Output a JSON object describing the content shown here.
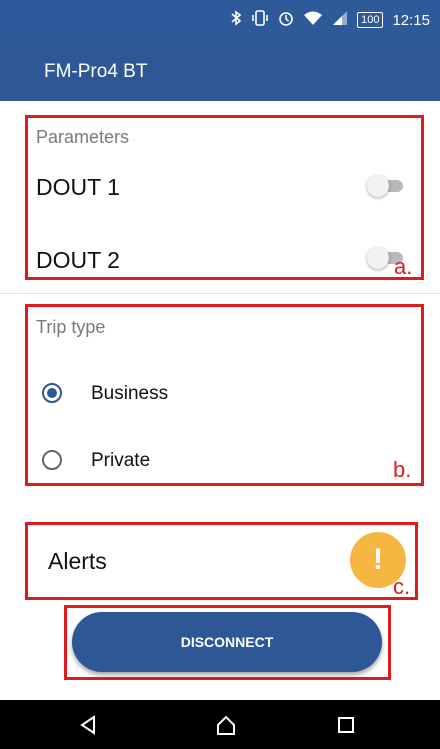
{
  "status_bar": {
    "battery": "100",
    "time": "12:15",
    "icons": [
      "bluetooth-icon",
      "vibrate-icon",
      "alarm-icon",
      "wifi-icon",
      "signal-icon"
    ]
  },
  "app_bar": {
    "title": "FM-Pro4 BT"
  },
  "parameters": {
    "heading": "Parameters",
    "items": [
      {
        "label": "DOUT 1",
        "enabled": false
      },
      {
        "label": "DOUT 2",
        "enabled": false
      }
    ],
    "annotation": "a."
  },
  "trip_type": {
    "heading": "Trip type",
    "options": [
      {
        "label": "Business",
        "selected": true
      },
      {
        "label": "Private",
        "selected": false
      }
    ],
    "annotation": "b."
  },
  "alerts": {
    "label": "Alerts",
    "icon_symbol": "!",
    "icon_color": "#f5b642",
    "annotation": "c."
  },
  "disconnect_label": "DISCONNECT",
  "colors": {
    "primary": "#2e5795",
    "highlight": "#e01b1b"
  }
}
